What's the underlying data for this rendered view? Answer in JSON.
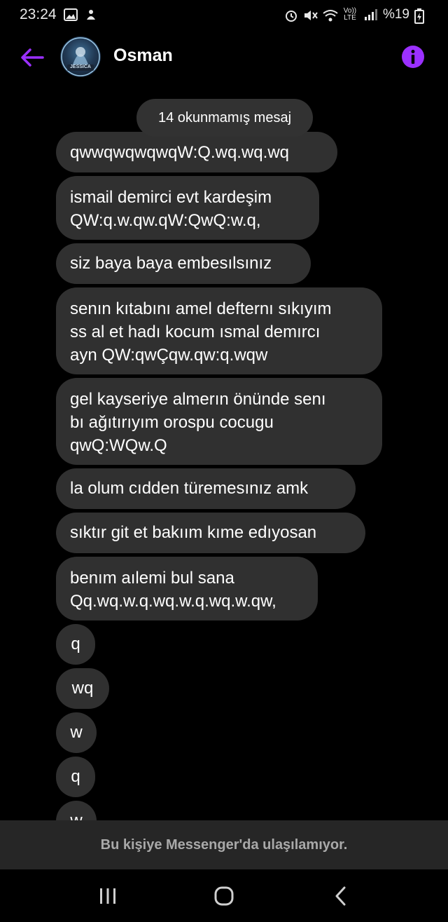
{
  "status_bar": {
    "time": "23:24",
    "battery": "%19",
    "network_label": "Vo)) LTE"
  },
  "header": {
    "contact_name": "Osman",
    "avatar_text": "JESSICA",
    "accent_color": "#9b30ff"
  },
  "unread_label": "14 okunmamış mesaj",
  "messages": [
    {
      "lines": [
        "qwwqwqwqwqW:Q.wq.wq.wq"
      ]
    },
    {
      "lines": [
        "ismail demirci evt kardeşim",
        "QW:q.w.qw.qW:QwQ:w.q,"
      ]
    },
    {
      "lines": [
        "siz baya baya embesılsınız"
      ]
    },
    {
      "lines": [
        "senın kıtabını amel defternı sıkıyım",
        "ss al et hadı kocum ısmal demırcı",
        "ayn QW:qwÇqw.qw:q.wqw"
      ]
    },
    {
      "lines": [
        "gel kayseriye almerın önünde senı",
        "bı ağıtırıyım orospu cocugu",
        "qwQ:WQw.Q"
      ]
    },
    {
      "lines": [
        "la olum cıdden türemesınız amk"
      ]
    },
    {
      "lines": [
        "sıktır git et bakıım kıme edıyosan"
      ]
    },
    {
      "lines": [
        "benım aılemi bul sana",
        "Qq.wq.w.q.wq.w.q.wq.w.qw,"
      ]
    },
    {
      "lines": [
        "q"
      ]
    },
    {
      "lines": [
        "wq"
      ]
    },
    {
      "lines": [
        "w"
      ]
    },
    {
      "lines": [
        "q"
      ]
    },
    {
      "lines": [
        "w"
      ]
    }
  ],
  "footer": {
    "unavailable_text": "Bu kişiye Messenger'da ulaşılamıyor."
  }
}
